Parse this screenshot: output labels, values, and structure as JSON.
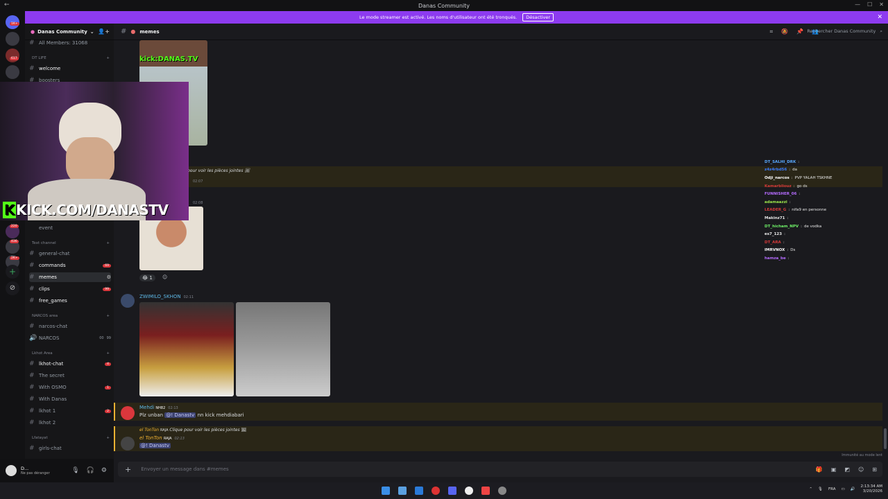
{
  "window": {
    "title": "Danas Community",
    "back": "←"
  },
  "banner": {
    "text": "Le mode streamer est activé. Les noms d'utilisateur ont été tronqués.",
    "button": "Désactiver",
    "close": "✕"
  },
  "rail": {
    "badges": [
      "1K+",
      "3",
      "617",
      "1"
    ],
    "lower_badges": [
      "220",
      "436",
      "2K+"
    ]
  },
  "server": {
    "name": "Danas Community",
    "chevron": "⌄"
  },
  "sidebar": {
    "all_members": "All Members: 31068",
    "categories": [
      {
        "name": "DT LIFE",
        "id": "dt-life"
      },
      {
        "name": "Text channel",
        "id": "text-channel"
      },
      {
        "name": "NARCOS area",
        "id": "narcos-area"
      },
      {
        "name": "Lkhot Area",
        "id": "lkhot-area"
      },
      {
        "name": "Lfatayat",
        "id": "lfatayat"
      }
    ],
    "channels": {
      "welcome": "welcome",
      "boosters": "boosters",
      "event": "event",
      "general_chat": "general-chat",
      "commands": "commands",
      "commands_badge": "69",
      "memes": "memes",
      "clips": "clips",
      "clips_badge": "99",
      "free_games": "free_games",
      "narcos_chat": "narcos-chat",
      "narcos": "NARCOS",
      "narcos_voice_a": "00",
      "narcos_voice_b": "99",
      "lkhot_chat": "lkhot-chat",
      "lkhot_chat_badge": "4",
      "the_secret": "The secret",
      "with_osmo": "With OSMO",
      "with_osmo_badge": "1",
      "with_danas": "With Danas",
      "lkhot_1": "lkhot 1",
      "lkhot_1_badge": "2",
      "lkhot_2": "lkhot 2",
      "girls_chat": "girls-chat"
    }
  },
  "user": {
    "name": "D...",
    "status": "Ne pas déranger"
  },
  "header": {
    "channel": "memes",
    "search_placeholder": "Rechercher Danas Community"
  },
  "messages": {
    "kick_overlay": "kick:DANAS.TV",
    "attachment_reply": "pour voir les pièces jointes",
    "ts_1": "02:07",
    "ts_2": "02:08",
    "reaction_count": "1",
    "msg3_author": "ZWIMILO_SKHON",
    "msg3_time": "02:11",
    "msg4_author": "Mehdi",
    "msg4_tag": "NH82",
    "msg4_time": "02:13",
    "msg4_mention": "@! Danastv",
    "msg4_text_pre": "Plz unban",
    "msg4_text_post": "nn kick mehdiabari",
    "msg5_reply_author": "el TonTon",
    "msg5_reply_tag": "RAJA",
    "msg5_reply_text": "Clique pour voir les pièces jointes",
    "msg5_author": "el TonTon",
    "msg5_tag": "RAJA",
    "msg5_time": "02:13",
    "msg5_mention": "@! Danastv",
    "lobby_note": "Immunité au mode lent"
  },
  "webcam": {
    "banner_k": "K",
    "banner_text": "KICK.COM/DANASTV"
  },
  "stream_chat": [
    {
      "user": "DT_SALHI_DRK",
      "text": "",
      "color": "#5aa9ff"
    },
    {
      "user": "z4z4rbd56",
      "text": "da",
      "color": "#3b7cff"
    },
    {
      "user": "Odji_narcos",
      "text": "PVP YALAH TSKHNE",
      "color": "#ffffff"
    },
    {
      "user": "Kamarbliouz",
      "text": "go ds",
      "color": "#d63a3a"
    },
    {
      "user": "FUNNISHER_06",
      "text": "",
      "color": "#b66cff"
    },
    {
      "user": "adamaazzi",
      "text": "",
      "color": "#9ee84c"
    },
    {
      "user": "LEADER_G",
      "text": "nifa9 en personne",
      "color": "#d63a3a"
    },
    {
      "user": "Makinz71",
      "text": "",
      "color": "#e6e6e6"
    },
    {
      "user": "DT_hicham_NPV",
      "text": "de vodka",
      "color": "#6ef067"
    },
    {
      "user": "es7_123",
      "text": "",
      "color": "#e6e6e6"
    },
    {
      "user": "DT_ARA",
      "text": "",
      "color": "#d63a3a"
    },
    {
      "user": "IMRVNOX",
      "text": "Ds",
      "color": "#ffffff"
    },
    {
      "user": "hamza_be",
      "text": "",
      "color": "#b66cff"
    }
  ],
  "composer": {
    "placeholder": "Envoyer un message dans #",
    "channel": "memes"
  },
  "taskbar": {
    "lang": "FRA",
    "time": "2:13:34 AM",
    "date": "3/20/2026"
  },
  "colors": {
    "accent": "#8d3bf0",
    "mention_bg": "#3c4270",
    "kick_green": "#53fc18"
  }
}
